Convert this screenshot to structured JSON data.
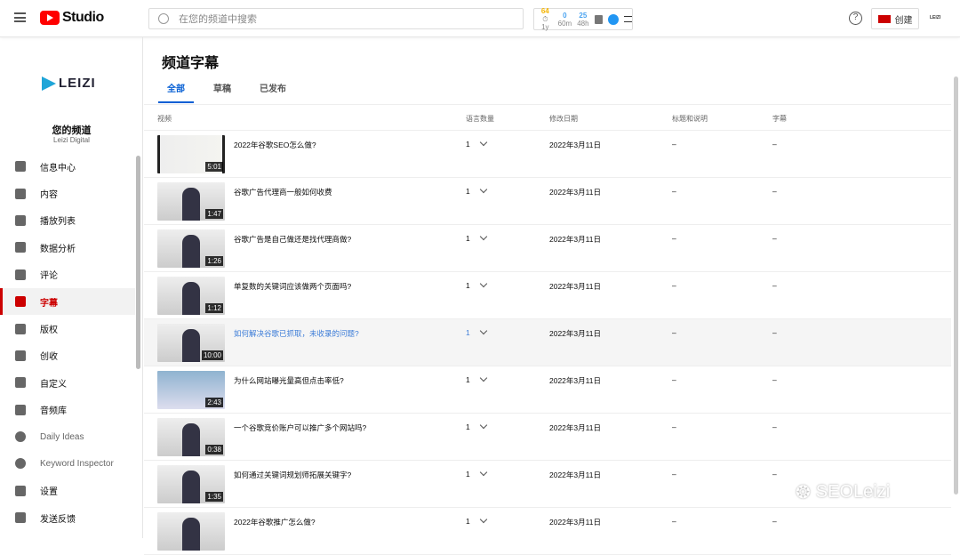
{
  "header": {
    "app": "Studio",
    "search_placeholder": "在您的频道中搜索",
    "stats": [
      {
        "value": "64",
        "label": "⏱ 1y",
        "color": "#f5b400"
      },
      {
        "value": "0",
        "label": "60m",
        "color": "#4aa3f0"
      },
      {
        "value": "25",
        "label": "48h",
        "color": "#4aa3f0"
      }
    ],
    "create_label": "创建",
    "help": "?",
    "avatar": "LEIZI"
  },
  "channel": {
    "logo": "LEIZI",
    "name": "您的频道",
    "handle": "Leizi Digital"
  },
  "sidebar": {
    "items": [
      {
        "label": "信息中心"
      },
      {
        "label": "内容"
      },
      {
        "label": "播放列表"
      },
      {
        "label": "数据分析"
      },
      {
        "label": "评论"
      },
      {
        "label": "字幕"
      },
      {
        "label": "版权"
      },
      {
        "label": "创收"
      },
      {
        "label": "自定义"
      },
      {
        "label": "音频库"
      },
      {
        "label": "Daily Ideas"
      },
      {
        "label": "Keyword Inspector"
      },
      {
        "label": "设置"
      },
      {
        "label": "发送反馈"
      }
    ],
    "active": "字幕"
  },
  "page": {
    "title": "频道字幕",
    "tabs": [
      "全部",
      "草稿",
      "已发布"
    ]
  },
  "table": {
    "columns": [
      "视频",
      "语言数量",
      "修改日期",
      "标题和说明",
      "字幕"
    ],
    "rows": [
      {
        "title": "2022年谷歌SEO怎么做?",
        "duration": "5:01",
        "langs": "1",
        "date": "2022年3月11日",
        "desc": "–",
        "subs": "–"
      },
      {
        "title": "谷歌广告代理商一般如何收费",
        "duration": "1:47",
        "langs": "1",
        "date": "2022年3月11日",
        "desc": "–",
        "subs": "–"
      },
      {
        "title": "谷歌广告是自己做还是找代理商做?",
        "duration": "1:26",
        "langs": "1",
        "date": "2022年3月11日",
        "desc": "–",
        "subs": "–"
      },
      {
        "title": "单复数的关键词应该做两个页面吗?",
        "duration": "1:12",
        "langs": "1",
        "date": "2022年3月11日",
        "desc": "–",
        "subs": "–"
      },
      {
        "title": "如何解决谷歌已抓取，未收录的问题?",
        "duration": "10:00",
        "langs": "1",
        "date": "2022年3月11日",
        "desc": "–",
        "subs": "–"
      },
      {
        "title": "为什么网站曝光量高但点击率低?",
        "duration": "2:43",
        "langs": "1",
        "date": "2022年3月11日",
        "desc": "–",
        "subs": "–"
      },
      {
        "title": "一个谷歌竞价账户可以推广多个网站吗?",
        "duration": "0:38",
        "langs": "1",
        "date": "2022年3月11日",
        "desc": "–",
        "subs": "–"
      },
      {
        "title": "如何通过关键词规划师拓展关键字?",
        "duration": "1:35",
        "langs": "1",
        "date": "2022年3月11日",
        "desc": "–",
        "subs": "–"
      },
      {
        "title": "2022年谷歌推广怎么做?",
        "duration": "",
        "langs": "1",
        "date": "2022年3月11日",
        "desc": "–",
        "subs": "–"
      }
    ]
  },
  "watermark": "SEOLeizi"
}
